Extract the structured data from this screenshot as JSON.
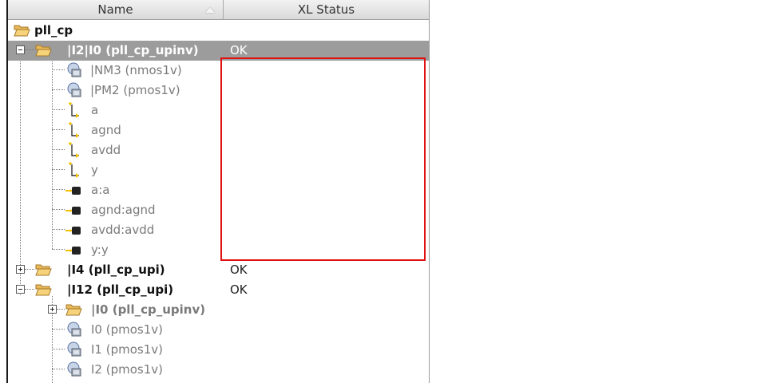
{
  "header": {
    "name_label": "Name",
    "status_label": "XL Status"
  },
  "tree": [
    {
      "label": "pll_cp",
      "status": "",
      "icon": "folder-icon"
    },
    {
      "label": "|I2|I0 (pll_cp_upinv)",
      "status": "OK",
      "icon": "folder-icon",
      "expander": "minus",
      "selected": true
    },
    {
      "label": "|NM3 (nmos1v)",
      "status": "",
      "icon": "instance-icon"
    },
    {
      "label": "|PM2 (pmos1v)",
      "status": "",
      "icon": "instance-icon"
    },
    {
      "label": "a",
      "status": "",
      "icon": "pin-icon"
    },
    {
      "label": "agnd",
      "status": "",
      "icon": "pin-icon"
    },
    {
      "label": "avdd",
      "status": "",
      "icon": "pin-icon"
    },
    {
      "label": "y",
      "status": "",
      "icon": "pin-icon"
    },
    {
      "label": "a:a",
      "status": "",
      "icon": "net-icon"
    },
    {
      "label": "agnd:agnd",
      "status": "",
      "icon": "net-icon"
    },
    {
      "label": "avdd:avdd",
      "status": "",
      "icon": "net-icon"
    },
    {
      "label": "y:y",
      "status": "",
      "icon": "net-icon"
    },
    {
      "label": "|I4 (pll_cp_upi)",
      "status": "OK",
      "icon": "folder-icon",
      "expander": "plus"
    },
    {
      "label": "|I12 (pll_cp_upi)",
      "status": "OK",
      "icon": "folder-icon",
      "expander": "minus"
    },
    {
      "label": "|I0 (pll_cp_upinv)",
      "status": "",
      "icon": "folder-icon",
      "expander": "plus"
    },
    {
      "label": "I0 (pmos1v)",
      "status": "",
      "icon": "instance-icon"
    },
    {
      "label": "I1 (pmos1v)",
      "status": "",
      "icon": "instance-icon"
    },
    {
      "label": "I2 (pmos1v)",
      "status": "",
      "icon": "instance-icon"
    }
  ],
  "colors": {
    "selection": "#9c9c9c",
    "highlight_box": "#e01010"
  }
}
